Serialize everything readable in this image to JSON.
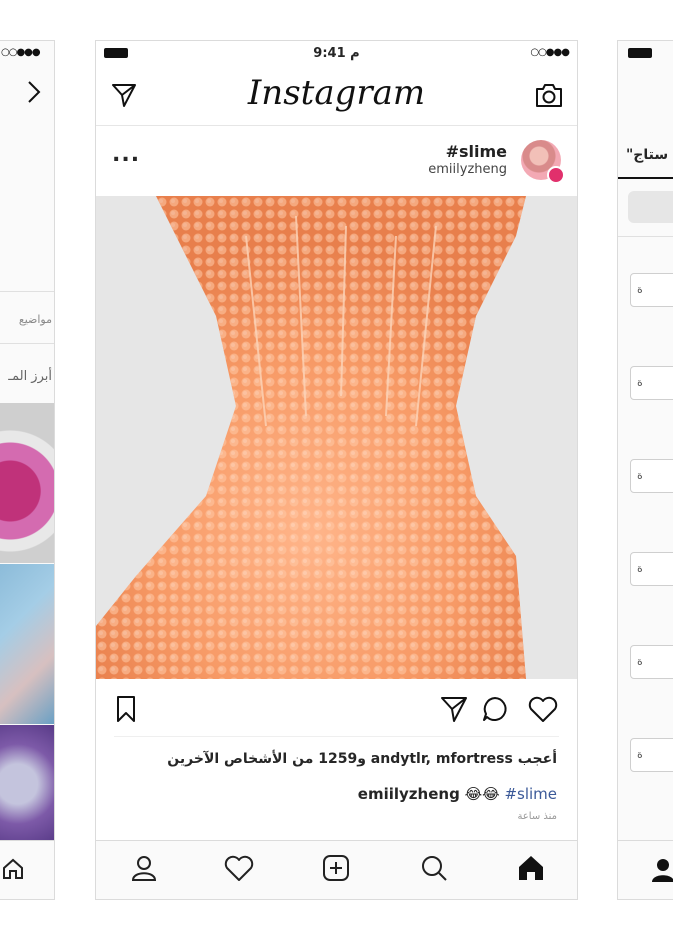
{
  "left_panel": {
    "signal": "○○●●●",
    "topics_label": "مواضيع",
    "top_label": "أبرز المـ"
  },
  "center": {
    "status": {
      "time": "9:41 م",
      "signal": "○○●●●"
    },
    "header": {
      "logo": "Instagram"
    },
    "post": {
      "hashtag": "#slime",
      "username": "emiilyzheng",
      "more": "...",
      "likes_text": "أعجب andytlr, mfortress و1259 من الأشخاص الآخرين",
      "caption_user": "emiilyzheng",
      "caption_emoji": "😂😂",
      "caption_tag": "#slime",
      "time_ago": "منذ ساعة"
    },
    "colors": {
      "accent_link": "#3b5998",
      "slime": "#f59a6a",
      "slime_light": "#ffc9a8",
      "badge": "#e1306c"
    }
  },
  "right_panel": {
    "search_text": "\"ستاج",
    "item_char": "ة"
  }
}
